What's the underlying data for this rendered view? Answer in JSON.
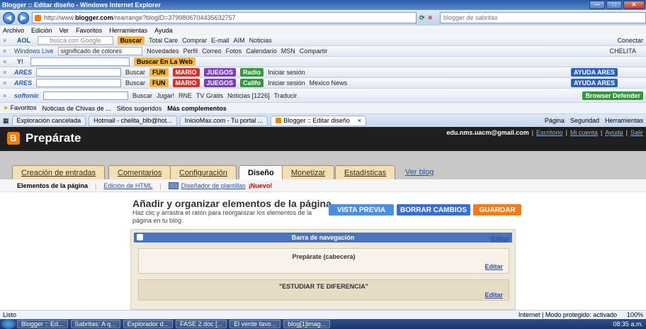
{
  "window": {
    "title": "Blogger :: Editar diseño - Windows Internet Explorer",
    "min": "—",
    "max": "□",
    "close": "✕"
  },
  "address": {
    "prefix": "http://www.",
    "domain": "blogger.com",
    "path": "/rearrange?blogID=3799806704435632757",
    "search_placeholder": "blogger de sabritas"
  },
  "menu": [
    "Archivo",
    "Edición",
    "Ver",
    "Favoritos",
    "Herramientas",
    "Ayuda"
  ],
  "toolbar1": {
    "aol": "AOL",
    "search_label": "busca con Google",
    "buscar": "Buscar",
    "items": [
      "Total Care",
      "Comprar",
      "E-mail",
      "AIM",
      "Noticias"
    ],
    "right": "Conectar"
  },
  "toolbar2": {
    "live": "Windows Live",
    "query": "significado de colores",
    "items": [
      "Novedades",
      "Perfil",
      "Correo",
      "Fotos",
      "Calendario",
      "MSN",
      "Compartir"
    ],
    "user": "CHELITA"
  },
  "toolbar3": {
    "yahoo": "Y!",
    "buscar": "Buscar En La Web"
  },
  "toolbar4": {
    "ares": "ARES",
    "buscar": "Buscar",
    "fun": "FUN",
    "mario": "MARIO",
    "juegos": "JUEGOS",
    "radio": "Radio",
    "login": "Iniciar sesión",
    "help": "AYUDA ARES"
  },
  "toolbar5": {
    "ares": "ARES",
    "buscar": "Buscar",
    "fun": "FUN",
    "mario": "MARIO",
    "juegos": "JUEGOS",
    "radio": "Califo",
    "login": "Iniciar sesión",
    "news": "Mexico News",
    "help": "AYUDA ARES"
  },
  "toolbar6": {
    "softonic": "softonic",
    "buscar": "Buscar",
    "jugar": "Jugar!",
    "rne": "RNE",
    "tv": "TV Gratis",
    "noticias": "Noticias [1226]",
    "traducir": "Traducir",
    "defender": "Browser Defender"
  },
  "favbar": {
    "favoritos": "Favoritos",
    "chivas": "Noticias de Chivas de ...",
    "sugeridos": "Sitios sugeridos",
    "complementos": "Más complementos"
  },
  "tabs": [
    {
      "label": "Exploración cancelada"
    },
    {
      "label": "Hotmail - chelita_blb@hot..."
    },
    {
      "label": "InicioMax.com - Tu portal ..."
    },
    {
      "label": "Blogger :: Editar diseño"
    }
  ],
  "tools": [
    "Página",
    "Seguridad",
    "Herramientas"
  ],
  "blog": {
    "title": "Prepárate",
    "email": "edu.nms.uacm@gmail.com",
    "links": [
      "Escritorio",
      "Mi cuenta",
      "Ayuda",
      "Salir"
    ],
    "tabs": [
      "Creación de entradas",
      "Comentarios",
      "Configuración",
      "Diseño",
      "Monetizar",
      "Estadísticas"
    ],
    "view_blog": "Ver blog",
    "subnav": {
      "current": "Elementos de la página",
      "html": "Edición de HTML",
      "designer": "Diseñador de plantillas",
      "new": "¡Nuevo!"
    },
    "heading": "Añadir y organizar elementos de la página",
    "description": "Haz clic y arrastra el ratón para reorganizar los elementos de la página en tu blog.",
    "buttons": {
      "preview": "VISTA PREVIA",
      "reset": "BORRAR CAMBIOS",
      "save": "GUARDAR"
    },
    "navbar_label": "Barra de navegación",
    "header_label": "Prepárate (cabecera)",
    "section_label": "\"ESTUDIAR TE DIFERENCIA\"",
    "edit": "Editar"
  },
  "status": {
    "left": "Listo",
    "zone": "Internet | Modo protegido: activado",
    "zoom": "100%"
  },
  "taskbar": {
    "items": [
      "Blogger :: Ed...",
      "Sabritas: A q...",
      "Explorador d...",
      "FASE 2.doc [...",
      "El verde favo...",
      "blog[1]imag..."
    ],
    "time": "08:35 a.m."
  },
  "colors": {
    "accent": "#f57d00",
    "link": "#2b4fa8",
    "preview_btn": "#4a8fe0",
    "reset_btn": "#3a6fcf",
    "save_btn": "#f07c1a"
  }
}
